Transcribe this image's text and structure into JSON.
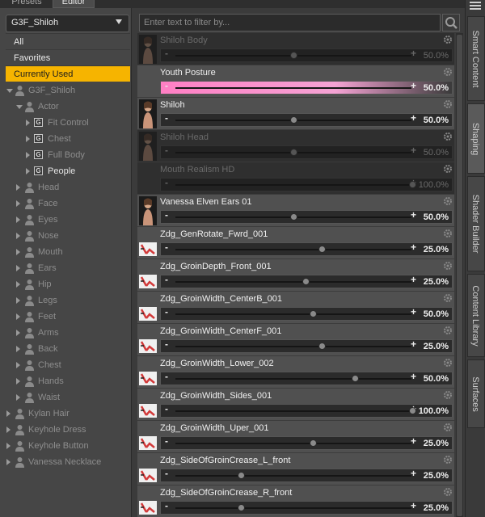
{
  "tabs": {
    "presets": "Presets",
    "editor": "Editor"
  },
  "figure_select": "G3F_Shiloh",
  "categories": [
    {
      "label": "All"
    },
    {
      "label": "Favorites"
    },
    {
      "label": "Currently Used",
      "selected": true
    }
  ],
  "tree": [
    {
      "label": "G3F_Shiloh",
      "indent": 0,
      "expand": "down",
      "icon": "person"
    },
    {
      "label": "Actor",
      "indent": 1,
      "expand": "down",
      "icon": "person"
    },
    {
      "label": "Fit Control",
      "indent": 2,
      "expand": "right",
      "icon": "group"
    },
    {
      "label": "Chest",
      "indent": 2,
      "expand": "right",
      "icon": "group"
    },
    {
      "label": "Full Body",
      "indent": 2,
      "expand": "right",
      "icon": "group"
    },
    {
      "label": "People",
      "indent": 2,
      "expand": "right",
      "icon": "group",
      "bright": true
    },
    {
      "label": "Head",
      "indent": 1,
      "expand": "right",
      "icon": "person"
    },
    {
      "label": "Face",
      "indent": 1,
      "expand": "right",
      "icon": "person"
    },
    {
      "label": "Eyes",
      "indent": 1,
      "expand": "right",
      "icon": "person"
    },
    {
      "label": "Nose",
      "indent": 1,
      "expand": "right",
      "icon": "person"
    },
    {
      "label": "Mouth",
      "indent": 1,
      "expand": "right",
      "icon": "person"
    },
    {
      "label": "Ears",
      "indent": 1,
      "expand": "right",
      "icon": "person"
    },
    {
      "label": "Hip",
      "indent": 1,
      "expand": "right",
      "icon": "person"
    },
    {
      "label": "Legs",
      "indent": 1,
      "expand": "right",
      "icon": "person"
    },
    {
      "label": "Feet",
      "indent": 1,
      "expand": "right",
      "icon": "person"
    },
    {
      "label": "Arms",
      "indent": 1,
      "expand": "right",
      "icon": "person"
    },
    {
      "label": "Back",
      "indent": 1,
      "expand": "right",
      "icon": "person"
    },
    {
      "label": "Chest",
      "indent": 1,
      "expand": "right",
      "icon": "person"
    },
    {
      "label": "Hands",
      "indent": 1,
      "expand": "right",
      "icon": "person"
    },
    {
      "label": "Waist",
      "indent": 1,
      "expand": "right",
      "icon": "person"
    },
    {
      "label": "Kylan Hair",
      "indent": 0,
      "expand": "right",
      "icon": "person"
    },
    {
      "label": "Keyhole Dress",
      "indent": 0,
      "expand": "right",
      "icon": "person"
    },
    {
      "label": "Keyhole Button",
      "indent": 0,
      "expand": "right",
      "icon": "person"
    },
    {
      "label": "Vanessa Necklace",
      "indent": 0,
      "expand": "right",
      "icon": "person"
    }
  ],
  "filter_placeholder": "Enter text to filter by...",
  "morphs": [
    {
      "name": "Shiloh Body",
      "value_label": "50.0%",
      "fraction": 0.5,
      "dim": true,
      "thumb": "figure"
    },
    {
      "name": "Youth Posture",
      "value_label": "50.0%",
      "fraction": 0.5,
      "pink": true,
      "thumb": "none"
    },
    {
      "name": "Shiloh",
      "value_label": "50.0%",
      "fraction": 0.5,
      "thumb": "figure"
    },
    {
      "name": "Shiloh Head",
      "value_label": "50.0%",
      "fraction": 0.5,
      "dim": true,
      "thumb": "head"
    },
    {
      "name": "Mouth Realism HD",
      "value_label": "100.0%",
      "fraction": 1.0,
      "dim": true,
      "thumb": "none"
    },
    {
      "name": "Vanessa Elven Ears 01",
      "value_label": "50.0%",
      "fraction": 0.5,
      "thumb": "head"
    },
    {
      "name": "Zdg_GenRotate_Fwrd_001",
      "value_label": "25.0%",
      "fraction": 0.62,
      "thumb": "morph"
    },
    {
      "name": "Zdg_GroinDepth_Front_001",
      "value_label": "25.0%",
      "fraction": 0.55,
      "thumb": "morph"
    },
    {
      "name": "Zdg_GroinWidth_CenterB_001",
      "value_label": "50.0%",
      "fraction": 0.58,
      "thumb": "morph"
    },
    {
      "name": "Zdg_GroinWidth_CenterF_001",
      "value_label": "25.0%",
      "fraction": 0.62,
      "thumb": "morph"
    },
    {
      "name": "Zdg_GroinWidth_Lower_002",
      "value_label": "50.0%",
      "fraction": 0.76,
      "thumb": "morph"
    },
    {
      "name": "Zdg_GroinWidth_Sides_001",
      "value_label": "100.0%",
      "fraction": 1.0,
      "thumb": "morph"
    },
    {
      "name": "Zdg_GroinWidth_Uper_001",
      "value_label": "25.0%",
      "fraction": 0.58,
      "thumb": "morph"
    },
    {
      "name": "Zdg_SideOfGroinCrease_L_front",
      "value_label": "25.0%",
      "fraction": 0.28,
      "thumb": "morph"
    },
    {
      "name": "Zdg_SideOfGroinCrease_R_front",
      "value_label": "25.0%",
      "fraction": 0.28,
      "thumb": "morph"
    }
  ],
  "side_tabs": [
    {
      "label": "Smart Content"
    },
    {
      "label": "Shaping",
      "active": true
    },
    {
      "label": "Shader Builder"
    },
    {
      "label": "Content Library"
    },
    {
      "label": "Surfaces"
    }
  ],
  "colors": {
    "selected": "#f6b400",
    "pink": "#ff7fc4",
    "morph_icon": "#d23a3a"
  },
  "icons": {
    "search": "search-icon",
    "gear": "gear-icon",
    "menu": "menu-icon"
  }
}
